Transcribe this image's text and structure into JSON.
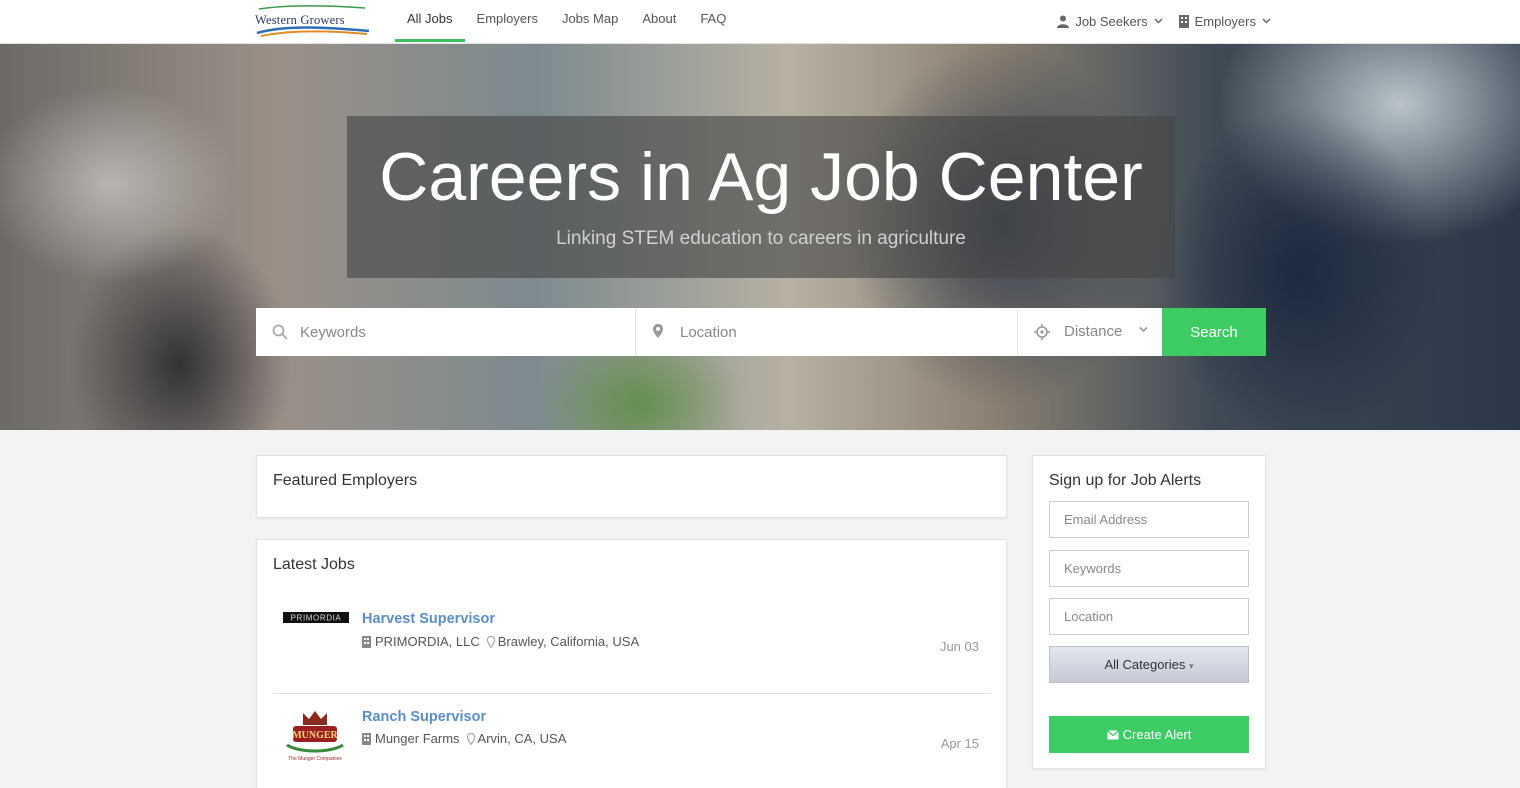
{
  "header": {
    "logo_text": "Western Growers",
    "nav": [
      "All Jobs",
      "Employers",
      "Jobs Map",
      "About",
      "FAQ"
    ],
    "job_seekers": "Job Seekers",
    "employers": "Employers"
  },
  "hero": {
    "title": "Careers in Ag Job Center",
    "subtitle": "Linking STEM education to careers in agriculture"
  },
  "search": {
    "keywords_placeholder": "Keywords",
    "location_placeholder": "Location",
    "distance": "Distance",
    "button": "Search"
  },
  "featured": {
    "title": "Featured Employers"
  },
  "latest": {
    "title": "Latest Jobs",
    "jobs": [
      {
        "title": "Harvest Supervisor",
        "company": "PRIMORDIA, LLC",
        "location": "Brawley, California, USA",
        "date": "Jun 03",
        "logo_text": "PRIMORDIA"
      },
      {
        "title": "Ranch Supervisor",
        "company": "Munger Farms",
        "location": "Arvin, CA, USA",
        "date": "Apr 15",
        "logo_text": "MUNGER",
        "logo_sub": "The Munger Companies"
      }
    ]
  },
  "alerts": {
    "title": "Sign up for Job Alerts",
    "email_placeholder": "Email Address",
    "keywords_placeholder": "Keywords",
    "location_placeholder": "Location",
    "categories": "All Categories",
    "create": "Create Alert"
  },
  "colors": {
    "accent_green": "#3dcc64",
    "link_blue": "#5b8ec7"
  }
}
